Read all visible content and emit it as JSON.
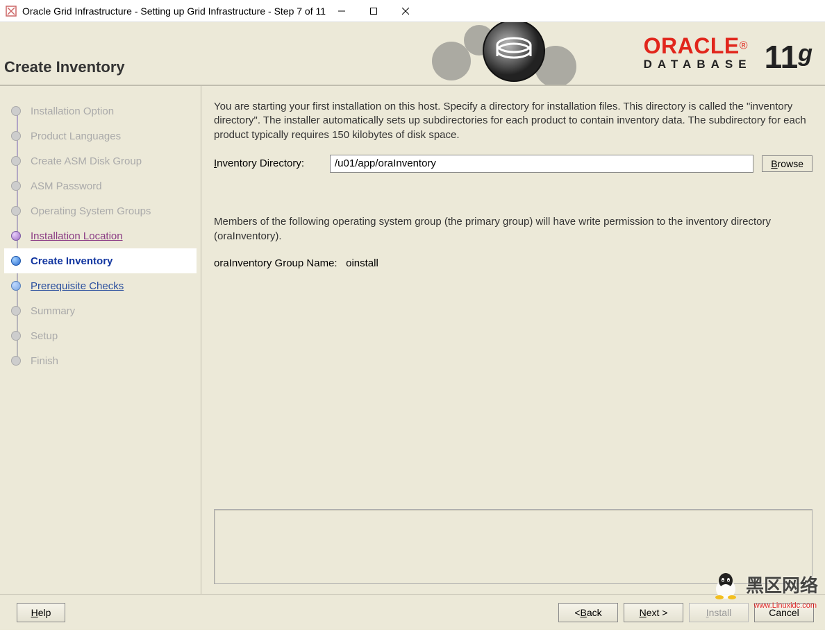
{
  "window": {
    "title": "Oracle Grid Infrastructure - Setting up Grid Infrastructure - Step 7 of 11"
  },
  "header": {
    "page_title": "Create Inventory",
    "logo_brand": "ORACLE",
    "logo_product": "DATABASE",
    "logo_version": "11",
    "logo_version_suffix": "g"
  },
  "sidebar": {
    "steps": [
      {
        "label": "Installation Option",
        "state": "disabled"
      },
      {
        "label": "Product Languages",
        "state": "disabled"
      },
      {
        "label": "Create ASM Disk Group",
        "state": "disabled"
      },
      {
        "label": "ASM Password",
        "state": "disabled"
      },
      {
        "label": "Operating System Groups",
        "state": "disabled"
      },
      {
        "label": "Installation Location",
        "state": "visited"
      },
      {
        "label": "Create Inventory",
        "state": "current"
      },
      {
        "label": "Prerequisite Checks",
        "state": "upnext"
      },
      {
        "label": "Summary",
        "state": "disabled"
      },
      {
        "label": "Setup",
        "state": "disabled"
      },
      {
        "label": "Finish",
        "state": "disabled"
      }
    ]
  },
  "main": {
    "intro": "You are starting your first installation on this host. Specify a directory for installation files. This directory is called the \"inventory directory\". The installer automatically sets up subdirectories for each product to contain inventory data. The subdirectory for each product typically requires 150 kilobytes of disk space.",
    "inventory_label_prefix": "I",
    "inventory_label_rest": "nventory Directory:",
    "inventory_value": "/u01/app/oraInventory",
    "browse_prefix": "B",
    "browse_rest": "rowse",
    "group_desc": "Members of the following operating system group (the primary group) will have write permission to the inventory directory (oraInventory).",
    "group_label": "oraInventory Group Name:",
    "group_value": "oinstall"
  },
  "footer": {
    "help_prefix": "H",
    "help_rest": "elp",
    "back_label": "< Back",
    "back_mnemonic": "B",
    "next_label": "Next >",
    "next_mnemonic": "N",
    "install_prefix": "I",
    "install_rest": "nstall",
    "cancel": "Cancel"
  },
  "watermark": {
    "text_cn": "黑区网络",
    "url": "www.Linuxidc.com"
  }
}
